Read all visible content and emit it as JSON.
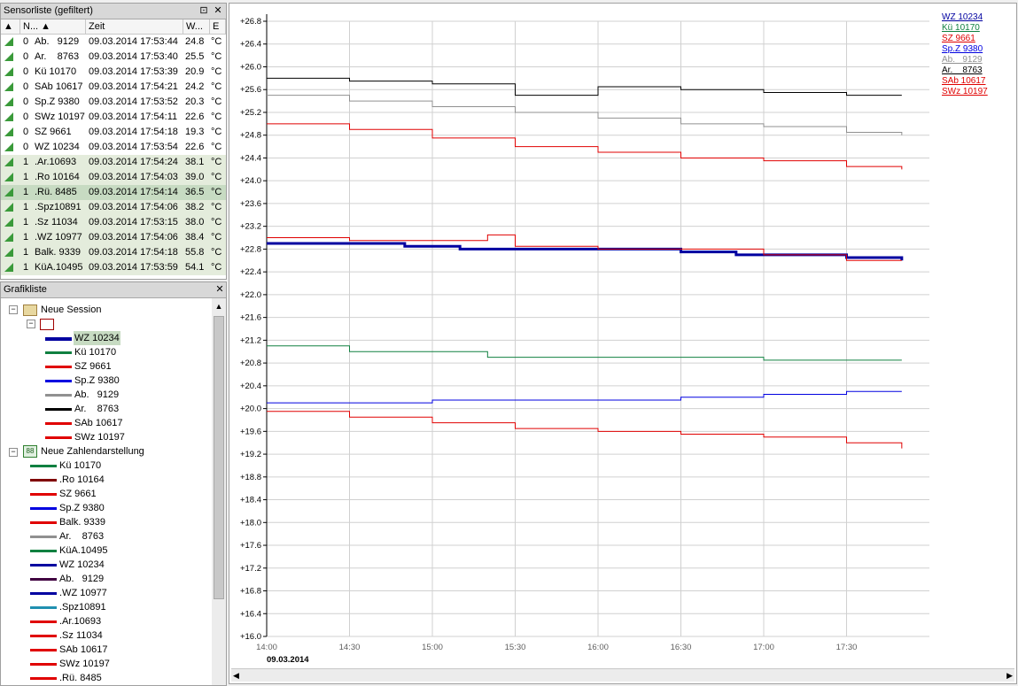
{
  "sensor_panel": {
    "title": "Sensorliste (gefiltert)",
    "pin_icon": "pin-icon",
    "close_icon": "close-icon",
    "columns": [
      "N...",
      "Zeit",
      "W...",
      "E"
    ],
    "rows": [
      {
        "n": "0",
        "name": "Ab.   9129",
        "time": "09.03.2014 17:53:44",
        "value": "24.8",
        "unit": "°C",
        "group": 0,
        "selected": false
      },
      {
        "n": "0",
        "name": "Ar.    8763",
        "time": "09.03.2014 17:53:40",
        "value": "25.5",
        "unit": "°C",
        "group": 0,
        "selected": false
      },
      {
        "n": "0",
        "name": "Kü 10170",
        "time": "09.03.2014 17:53:39",
        "value": "20.9",
        "unit": "°C",
        "group": 0,
        "selected": false
      },
      {
        "n": "0",
        "name": "SAb 10617",
        "time": "09.03.2014 17:54:21",
        "value": "24.2",
        "unit": "°C",
        "group": 0,
        "selected": false
      },
      {
        "n": "0",
        "name": "Sp.Z 9380",
        "time": "09.03.2014 17:53:52",
        "value": "20.3",
        "unit": "°C",
        "group": 0,
        "selected": false
      },
      {
        "n": "0",
        "name": "SWz 10197",
        "time": "09.03.2014 17:54:11",
        "value": "22.6",
        "unit": "°C",
        "group": 0,
        "selected": false
      },
      {
        "n": "0",
        "name": "SZ 9661",
        "time": "09.03.2014 17:54:18",
        "value": "19.3",
        "unit": "°C",
        "group": 0,
        "selected": false
      },
      {
        "n": "0",
        "name": "WZ 10234",
        "time": "09.03.2014 17:53:54",
        "value": "22.6",
        "unit": "°C",
        "group": 0,
        "selected": false
      },
      {
        "n": "1",
        "name": ".Ar.10693",
        "time": "09.03.2014 17:54:24",
        "value": "38.1",
        "unit": "°C",
        "group": 1,
        "selected": false
      },
      {
        "n": "1",
        "name": ".Ro 10164",
        "time": "09.03.2014 17:54:03",
        "value": "39.0",
        "unit": "°C",
        "group": 1,
        "selected": false
      },
      {
        "n": "1",
        "name": ".Rü. 8485",
        "time": "09.03.2014 17:54:14",
        "value": "36.5",
        "unit": "°C",
        "group": 1,
        "selected": true
      },
      {
        "n": "1",
        "name": ".Spz10891",
        "time": "09.03.2014 17:54:06",
        "value": "38.2",
        "unit": "°C",
        "group": 1,
        "selected": false
      },
      {
        "n": "1",
        "name": ".Sz 11034",
        "time": "09.03.2014 17:53:15",
        "value": "38.0",
        "unit": "°C",
        "group": 1,
        "selected": false
      },
      {
        "n": "1",
        "name": ".WZ 10977",
        "time": "09.03.2014 17:54:06",
        "value": "38.4",
        "unit": "°C",
        "group": 1,
        "selected": false
      },
      {
        "n": "1",
        "name": "Balk. 9339",
        "time": "09.03.2014 17:54:18",
        "value": "55.8",
        "unit": "°C",
        "group": 1,
        "selected": false
      },
      {
        "n": "1",
        "name": "KüA.10495",
        "time": "09.03.2014 17:53:59",
        "value": "54.1",
        "unit": "°C",
        "group": 1,
        "selected": false
      }
    ]
  },
  "graph_panel": {
    "title": "Grafikliste",
    "close_icon": "close-icon",
    "session_label": "Neue Session",
    "session_items": [
      {
        "label": "WZ 10234",
        "color": "#0000a0",
        "selected": true
      },
      {
        "label": "Kü 10170",
        "color": "#108040",
        "selected": false
      },
      {
        "label": "SZ 9661",
        "color": "#e00000",
        "selected": false
      },
      {
        "label": "Sp.Z 9380",
        "color": "#0000e0",
        "selected": false
      },
      {
        "label": "Ab.   9129",
        "color": "#909090",
        "selected": false
      },
      {
        "label": "Ar.    8763",
        "color": "#000000",
        "selected": false
      },
      {
        "label": "SAb 10617",
        "color": "#e00000",
        "selected": false
      },
      {
        "label": "SWz 10197",
        "color": "#e00000",
        "selected": false
      }
    ],
    "zahlen_label": "Neue Zahlendarstellung",
    "zahlen_icon_text": "88",
    "zahlen_items": [
      {
        "label": "Kü 10170",
        "color": "#108040"
      },
      {
        "label": ".Ro 10164",
        "color": "#800000"
      },
      {
        "label": "SZ 9661",
        "color": "#e00000"
      },
      {
        "label": "Sp.Z 9380",
        "color": "#0000e0"
      },
      {
        "label": "Balk. 9339",
        "color": "#e00000"
      },
      {
        "label": "Ar.    8763",
        "color": "#909090"
      },
      {
        "label": "KüA.10495",
        "color": "#108040"
      },
      {
        "label": "WZ 10234",
        "color": "#0000a0"
      },
      {
        "label": "Ab.   9129",
        "color": "#400040"
      },
      {
        "label": ".WZ 10977",
        "color": "#0000a0"
      },
      {
        "label": ".Spz10891",
        "color": "#2090b0"
      },
      {
        "label": ".Ar.10693",
        "color": "#e00000"
      },
      {
        "label": ".Sz 11034",
        "color": "#e00000"
      },
      {
        "label": "SAb 10617",
        "color": "#e00000"
      },
      {
        "label": "SWz 10197",
        "color": "#e00000"
      },
      {
        "label": ".Rü. 8485",
        "color": "#e00000"
      }
    ]
  },
  "chart_data": {
    "type": "line",
    "title": "",
    "xlabel": "",
    "ylabel": "",
    "date_label": "09.03.2014",
    "x_ticks": [
      "14:00",
      "14:30",
      "15:00",
      "15:30",
      "16:00",
      "16:30",
      "17:00",
      "17:30"
    ],
    "x_range": [
      "14:00",
      "18:00"
    ],
    "y_ticks": [
      "+16.0",
      "+16.4",
      "+16.8",
      "+17.2",
      "+17.6",
      "+18.0",
      "+18.4",
      "+18.8",
      "+19.2",
      "+19.6",
      "+20.0",
      "+20.4",
      "+20.8",
      "+21.2",
      "+21.6",
      "+22.0",
      "+22.4",
      "+22.8",
      "+23.2",
      "+23.6",
      "+24.0",
      "+24.4",
      "+24.8",
      "+25.2",
      "+25.6",
      "+26.0",
      "+26.4",
      "+26.8"
    ],
    "ylim": [
      16.0,
      26.8
    ],
    "grid": true,
    "legend_position": "top-right",
    "series": [
      {
        "name": "WZ 10234",
        "color": "#0000a0",
        "width": 3,
        "x": [
          "14:00",
          "14:30",
          "14:50",
          "15:10",
          "15:30",
          "15:50",
          "16:10",
          "16:30",
          "16:50",
          "17:10",
          "17:30",
          "17:50"
        ],
        "y": [
          22.9,
          22.9,
          22.85,
          22.8,
          22.8,
          22.8,
          22.8,
          22.75,
          22.7,
          22.7,
          22.65,
          22.6
        ]
      },
      {
        "name": "Kü 10170",
        "color": "#108040",
        "width": 1,
        "x": [
          "14:00",
          "14:30",
          "15:00",
          "15:20",
          "15:30",
          "16:00",
          "16:30",
          "17:00",
          "17:30",
          "17:50"
        ],
        "y": [
          21.1,
          21.0,
          21.0,
          20.9,
          20.9,
          20.9,
          20.9,
          20.85,
          20.85,
          20.85
        ]
      },
      {
        "name": "SZ 9661",
        "color": "#e00000",
        "width": 1,
        "x": [
          "14:00",
          "14:30",
          "15:00",
          "15:30",
          "16:00",
          "16:30",
          "17:00",
          "17:30",
          "17:50"
        ],
        "y": [
          19.95,
          19.85,
          19.75,
          19.65,
          19.6,
          19.55,
          19.5,
          19.4,
          19.3
        ]
      },
      {
        "name": "Sp.Z 9380",
        "color": "#0000e0",
        "width": 1,
        "x": [
          "14:00",
          "14:30",
          "15:00",
          "15:30",
          "16:00",
          "16:30",
          "17:00",
          "17:30",
          "17:50"
        ],
        "y": [
          20.1,
          20.1,
          20.15,
          20.15,
          20.15,
          20.2,
          20.25,
          20.3,
          20.3
        ]
      },
      {
        "name": "Ab.   9129",
        "color": "#909090",
        "width": 1,
        "x": [
          "14:00",
          "14:30",
          "15:00",
          "15:30",
          "16:00",
          "16:30",
          "17:00",
          "17:30",
          "17:50"
        ],
        "y": [
          25.5,
          25.4,
          25.3,
          25.2,
          25.1,
          25.0,
          24.95,
          24.85,
          24.8
        ]
      },
      {
        "name": "Ar.    8763",
        "color": "#000000",
        "width": 1,
        "x": [
          "14:00",
          "14:30",
          "15:00",
          "15:30",
          "16:00",
          "16:30",
          "17:00",
          "17:30",
          "17:50"
        ],
        "y": [
          25.8,
          25.75,
          25.7,
          25.5,
          25.65,
          25.6,
          25.55,
          25.5,
          25.5
        ]
      },
      {
        "name": "SAb 10617",
        "color": "#e00000",
        "width": 1,
        "x": [
          "14:00",
          "14:30",
          "15:00",
          "15:30",
          "16:00",
          "16:30",
          "17:00",
          "17:30",
          "17:50"
        ],
        "y": [
          25.0,
          24.9,
          24.75,
          24.6,
          24.5,
          24.4,
          24.35,
          24.25,
          24.2
        ]
      },
      {
        "name": "SWz 10197",
        "color": "#e00000",
        "width": 1,
        "x": [
          "14:00",
          "14:30",
          "15:00",
          "15:20",
          "15:30",
          "16:00",
          "16:30",
          "17:00",
          "17:30",
          "17:50"
        ],
        "y": [
          23.0,
          22.95,
          22.95,
          23.05,
          22.85,
          22.8,
          22.8,
          22.7,
          22.6,
          22.6
        ]
      }
    ]
  },
  "chart_legend": [
    "WZ 10234",
    "Kü 10170",
    "SZ 9661",
    "Sp.Z 9380",
    "Ab.   9129",
    "Ar.    8763",
    "SAb 10617",
    "SWz 10197"
  ]
}
